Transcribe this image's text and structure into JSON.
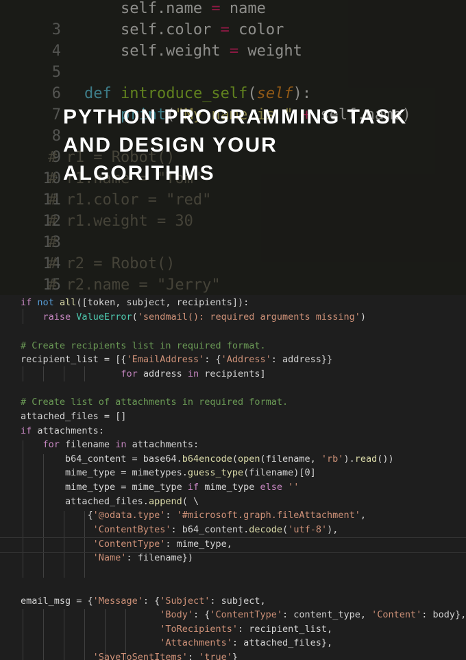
{
  "headline": {
    "line1": "PYTHON PROGRAMMING TASK",
    "line2": "AND DESIGN YOUR",
    "line3": "ALGORITHMS"
  },
  "top_code": [
    {
      "ln": "3",
      "code": "        self.name = name"
    },
    {
      "ln": "4",
      "code": "        self.color = color"
    },
    {
      "ln": "5",
      "code": "        self.weight = weight"
    },
    {
      "ln": "6",
      "code": ""
    },
    {
      "ln": "7",
      "code": "    def introduce_self(self):"
    },
    {
      "ln": "8",
      "code": "        print(\"My name is \" + self.name)"
    },
    {
      "ln": "9",
      "code": ""
    },
    {
      "ln": "10",
      "code": "# r1 = Robot()"
    },
    {
      "ln": "11",
      "code": "# r1.name = \"Tom\""
    },
    {
      "ln": "12",
      "code": "# r1.color = \"red\""
    },
    {
      "ln": "13",
      "code": "# r1.weight = 30"
    },
    {
      "ln": "14",
      "code": "#"
    },
    {
      "ln": "15",
      "code": "# r2 = Robot()"
    },
    {
      "ln": "16",
      "code": "# r2.name = \"Jerry\""
    }
  ],
  "bottom_code": [
    "if not all([token, subject, recipients]):",
    "    raise ValueError('sendmail(): required arguments missing')",
    "",
    "# Create recipients list in required format.",
    "recipient_list = [{'EmailAddress': {'Address': address}}",
    "                  for address in recipients]",
    "",
    "# Create list of attachments in required format.",
    "attached_files = []",
    "if attachments:",
    "    for filename in attachments:",
    "        b64_content = base64.b64encode(open(filename, 'rb').read())",
    "        mime_type = mimetypes.guess_type(filename)[0]",
    "        mime_type = mime_type if mime_type else ''",
    "        attached_files.append( \\",
    "            {'@odata.type': '#microsoft.graph.fileAttachment',",
    "             'ContentBytes': b64_content.decode('utf-8'),",
    "             'ContentType': mime_type,",
    "             'Name': filename})",
    "",
    "",
    "email_msg = {'Message': {'Subject': subject,",
    "                         'Body': {'ContentType': content_type, 'Content': body},",
    "                         'ToRecipients': recipient_list,",
    "                         'Attachments': attached_files},",
    "             'SaveToSentItems': 'true'}"
  ],
  "colors": {
    "top_bg": "#272822",
    "bottom_bg": "#1e1e1e",
    "headline": "#ffffff"
  }
}
